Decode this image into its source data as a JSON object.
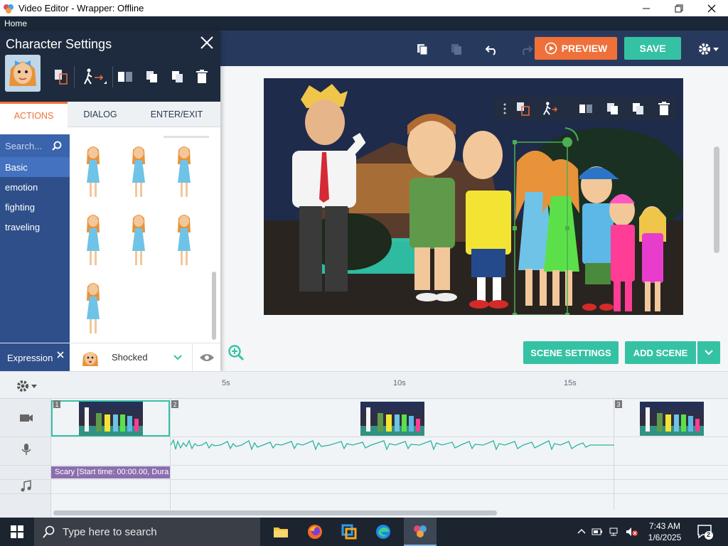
{
  "window": {
    "title": "Video Editor - Wrapper: Offline"
  },
  "menu": {
    "home": "Home"
  },
  "toolbar": {
    "preview_label": "PREVIEW",
    "save_label": "SAVE"
  },
  "panel": {
    "title": "Character Settings",
    "tabs": [
      {
        "label": "ACTIONS"
      },
      {
        "label": "DIALOG"
      },
      {
        "label": "ENTER/EXIT"
      }
    ],
    "search_placeholder": "Search...",
    "categories": [
      {
        "label": "Basic"
      },
      {
        "label": "emotion"
      },
      {
        "label": "fighting"
      },
      {
        "label": "traveling"
      }
    ],
    "expression": {
      "label": "Expression",
      "value": "Shocked"
    }
  },
  "stage": {
    "scene_settings_label": "SCENE SETTINGS",
    "add_scene_label": "ADD SCENE"
  },
  "timeline": {
    "ticks": [
      {
        "label": "5s"
      },
      {
        "label": "10s"
      },
      {
        "label": "15s"
      }
    ],
    "scene_numbers": [
      {
        "label": "1"
      },
      {
        "label": "2"
      },
      {
        "label": "3"
      }
    ],
    "music_clip": "Scary [Start time: 00:00.00, Dura"
  },
  "taskbar": {
    "search_placeholder": "Type here to search",
    "time": "7:43 AM",
    "date": "1/6/2025",
    "notification_count": "2"
  },
  "colors": {
    "accent_teal": "#35c2a4",
    "accent_orange": "#f0703a",
    "panel_navy": "#1e2a3d",
    "category_blue": "#2e4f8a"
  }
}
